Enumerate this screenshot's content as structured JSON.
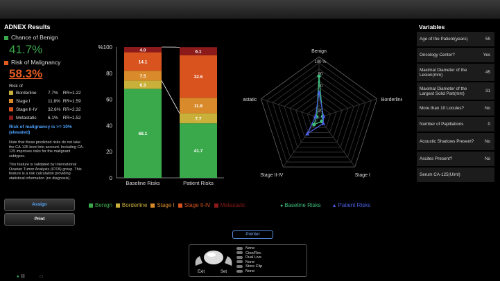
{
  "title": "ADNEX Results",
  "benign": {
    "label": "Chance of Benign",
    "value": "41.7%",
    "color": "#3aa94b"
  },
  "malignancy": {
    "label": "Risk of Malignancy",
    "value": "58.3%",
    "color": "#e25b20"
  },
  "risk_of_label": "Risk of",
  "subtypes": [
    {
      "name": "Borderline",
      "pct": "7.7%",
      "rr": "RR=1.22",
      "color": "#c9b03a"
    },
    {
      "name": "Stage I",
      "pct": "11.8%",
      "rr": "RR=1.59",
      "color": "#d98a2a"
    },
    {
      "name": "Stage II-IV",
      "pct": "32.6%",
      "rr": "RR=2.32",
      "color": "#d9531e"
    },
    {
      "name": "Metastatic",
      "pct": "6.1%",
      "rr": "RR=1.52",
      "color": "#8c1a1a"
    }
  ],
  "warning": "Risk of malignancy is >= 10% (elevated)",
  "note1": "Note that these predicted risks do not take the CA-125 level into account. Including CA-125 improves risks for the malignant subtypes.",
  "note2": "This feature is validated by International Ovarian Tumor Analysis (IOTA) group. This feature is a risk calculation providing statistical information (no diagnosis).",
  "buttons": {
    "assign": "Assign",
    "print": "Print"
  },
  "chart_data": [
    {
      "type": "bar",
      "categories": [
        "Baseline Risks",
        "Patient Risks"
      ],
      "series": [
        {
          "name": "Benign",
          "values": [
            68.1,
            41.7
          ],
          "color": "#3aa94b"
        },
        {
          "name": "Borderline",
          "values": [
            6.3,
            7.7
          ],
          "color": "#c9b03a"
        },
        {
          "name": "Stage I",
          "values": [
            7.5,
            11.8
          ],
          "color": "#d98a2a"
        },
        {
          "name": "Stage II-IV",
          "values": [
            14.1,
            32.6
          ],
          "color": "#d9531e"
        },
        {
          "name": "Metastatic",
          "values": [
            4.0,
            6.1
          ],
          "color": "#8c1a1a"
        }
      ],
      "ylabel": "%",
      "yticks": [
        "0",
        "20",
        "40",
        "60",
        "80",
        "%100"
      ],
      "ylim": [
        0,
        100
      ],
      "stacked": true
    },
    {
      "type": "radar",
      "axes": [
        "Benign",
        "Borderline",
        "Stage I",
        "Stage II-IV",
        "Metastatic"
      ],
      "rlabels": [
        "20",
        "60",
        "80",
        "100 %"
      ],
      "rlim": [
        0,
        100
      ],
      "series": [
        {
          "name": "Baseline Risks",
          "values": [
            68.1,
            6.3,
            7.5,
            14.1,
            4.0
          ],
          "color": "#3fbf7f",
          "marker": "circle"
        },
        {
          "name": "Patient Risks",
          "values": [
            41.7,
            7.7,
            11.8,
            32.6,
            6.1
          ],
          "color": "#4a5fe0",
          "marker": "triangle"
        }
      ]
    }
  ],
  "variables": {
    "title": "Variables",
    "rows": [
      {
        "label": "Age of the Patient(years)",
        "value": "55"
      },
      {
        "label": "Oncology Center?",
        "value": "Yes"
      },
      {
        "label": "Maximal Diameter of the Lesion(mm)",
        "value": "45"
      },
      {
        "label": "Maximal Diameter of the Largest Solid Part(mm)",
        "value": "31"
      },
      {
        "label": "More than 10 Locules?",
        "value": "No"
      },
      {
        "label": "Number of Papillations",
        "value": "0"
      },
      {
        "label": "Acoustic Shadows Present?",
        "value": "No"
      },
      {
        "label": "Ascites Present?",
        "value": "No"
      },
      {
        "label": "Serum CA-125(U/ml)",
        "value": ""
      }
    ]
  },
  "pointer_label": "Pointer",
  "control": {
    "exit_label": "Exit",
    "set_label": "Set",
    "items": [
      "None",
      "Cine/Rec",
      "Dual Live",
      "None",
      "Store Clip",
      "None"
    ]
  }
}
